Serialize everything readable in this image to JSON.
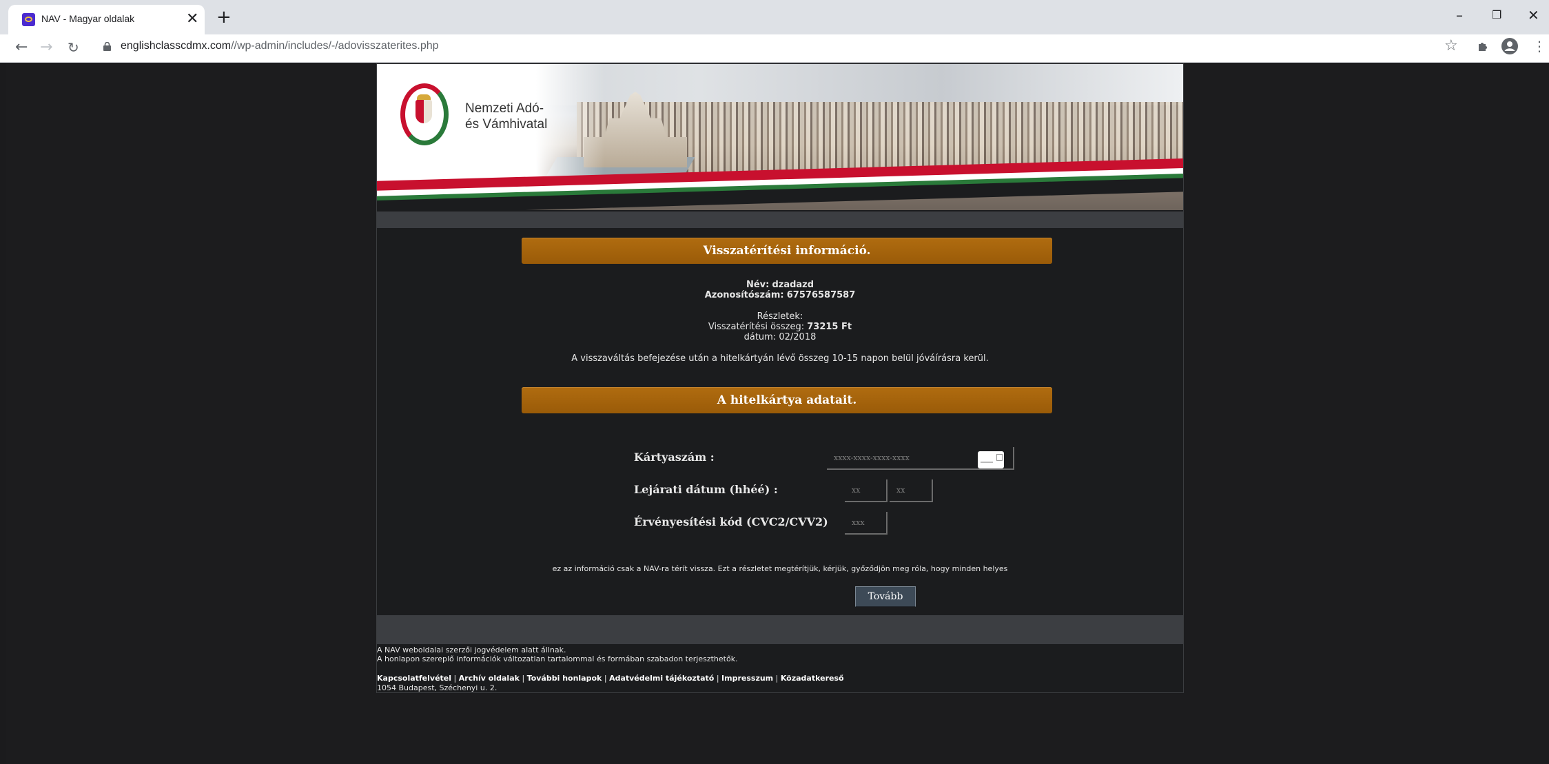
{
  "browser": {
    "tab_title": "NAV - Magyar oldalak",
    "tab_close": "✕",
    "new_tab": "+",
    "url_host": "englishclasscdmx.com",
    "url_path": "//wp-admin/includes/-/adovisszaterites.php",
    "icons": [
      "back-icon",
      "forward-icon",
      "reload-icon",
      "lock-icon",
      "star-icon",
      "extensions-icon",
      "profile-icon",
      "menu-icon",
      "minimize-icon",
      "restore-icon",
      "close-icon"
    ]
  },
  "header": {
    "logo_line1": "Nemzeti Adó-",
    "logo_line2": "és Vámhivatal"
  },
  "refund": {
    "title": "Visszatérítési információ.",
    "name_label": "Név:",
    "name_value": "dzadazd",
    "id_label": "Azonosítószám:",
    "id_value": "67576587587",
    "details_label": "Részletek:",
    "amount_label": "Visszatérítési összeg:",
    "amount_value": "73215 Ft",
    "date_label": "dátum:",
    "date_value": "02/2018",
    "notice": "A visszaváltás befejezése után a hitelkártyán lévő összeg 10-15 napon belül jóváírásra kerül."
  },
  "card": {
    "title": "A hitelkártya adatait.",
    "number_label": "Kártyaszám :",
    "number_placeholder": "xxxx-xxxx-xxxx-xxxx",
    "expiry_label": "Lejárati dátum (hhéé) :",
    "expiry_month_placeholder": "xx",
    "expiry_year_placeholder": "xx",
    "cvc_label": "Érvényesítési kód (CVC2/CVV2)",
    "cvc_placeholder": "xxx",
    "note": "ez az információ csak a NAV-ra térít vissza. Ezt a részletet megtérítjük, kérjük, győződjön meg róla, hogy minden helyes",
    "submit_label": "Tovább"
  },
  "footer": {
    "line1": "A NAV weboldalai szerzői jogvédelem alatt állnak.",
    "line2": "A honlapon szereplő információk változatlan tartalommal és formában szabadon terjeszthetők.",
    "links": [
      "Kapcsolatfelvétel",
      "Archív oldalak",
      "További honlapok",
      "Adatvédelmi tájékoztató",
      "Impresszum",
      "Közadatkereső"
    ],
    "separator": " | ",
    "address": "1054 Budapest, Széchenyi u. 2."
  }
}
